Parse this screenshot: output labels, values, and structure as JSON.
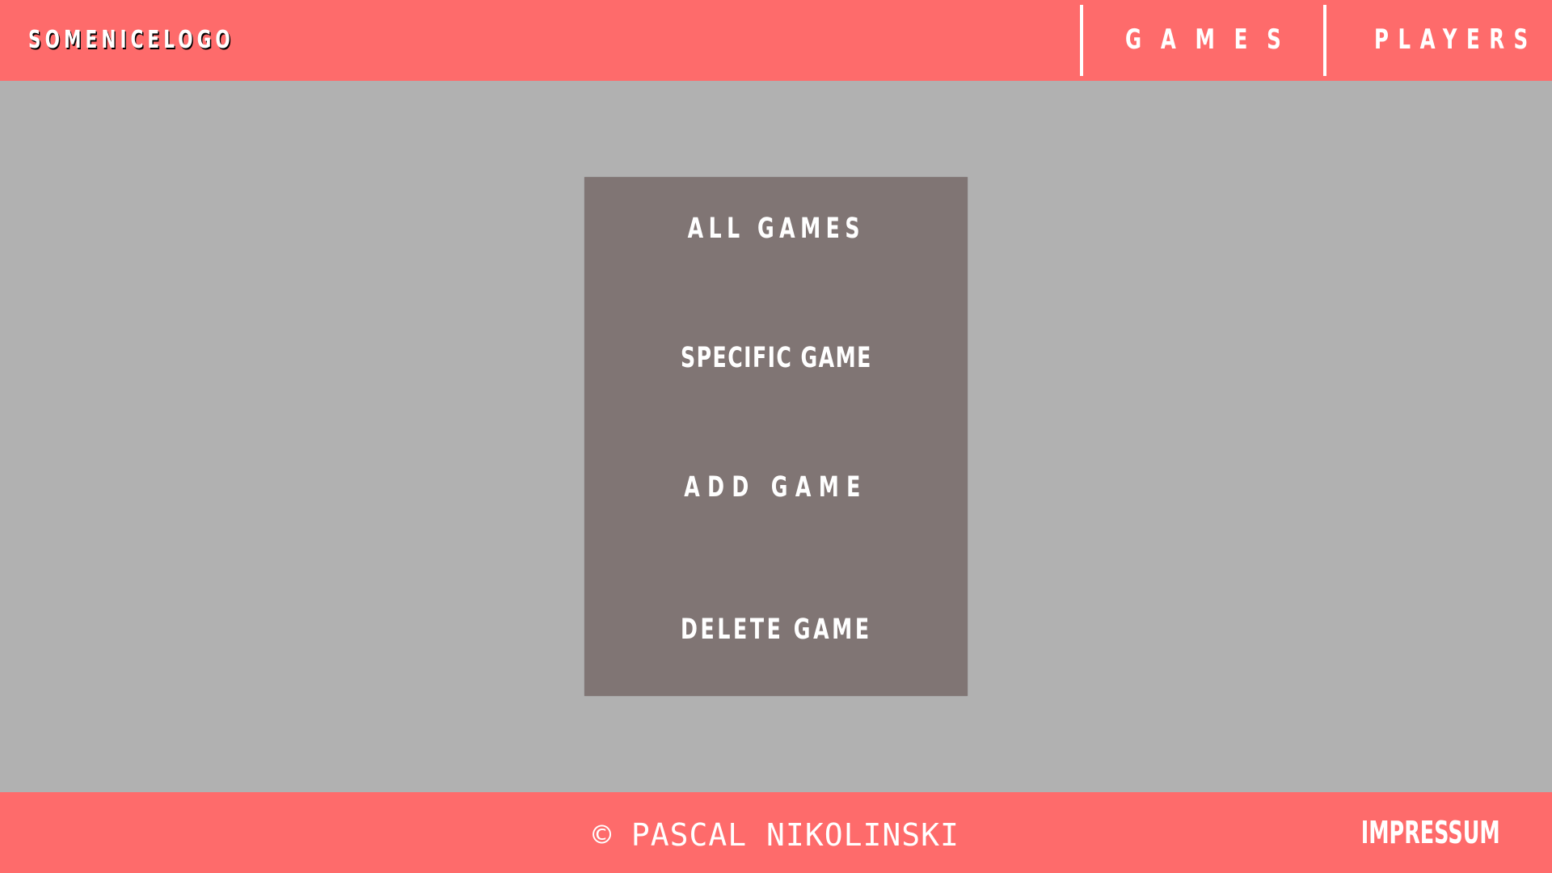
{
  "header": {
    "logo": "SOMENICELOGO",
    "nav": [
      {
        "label": "GAMES"
      },
      {
        "label": "PLAYERS"
      }
    ]
  },
  "menu": {
    "items": [
      {
        "label": "ALL GAMES"
      },
      {
        "label": "SPECIFIC GAME"
      },
      {
        "label": "ADD GAME"
      },
      {
        "label": "DELETE GAME"
      }
    ]
  },
  "footer": {
    "copyright": "© PASCAL NIKOLINSKI",
    "impressum": "IMPRESSUM"
  },
  "colors": {
    "accent": "#fe6b6b",
    "background": "#b1b1b1",
    "panel": "#807574",
    "text": "#ffffff"
  }
}
